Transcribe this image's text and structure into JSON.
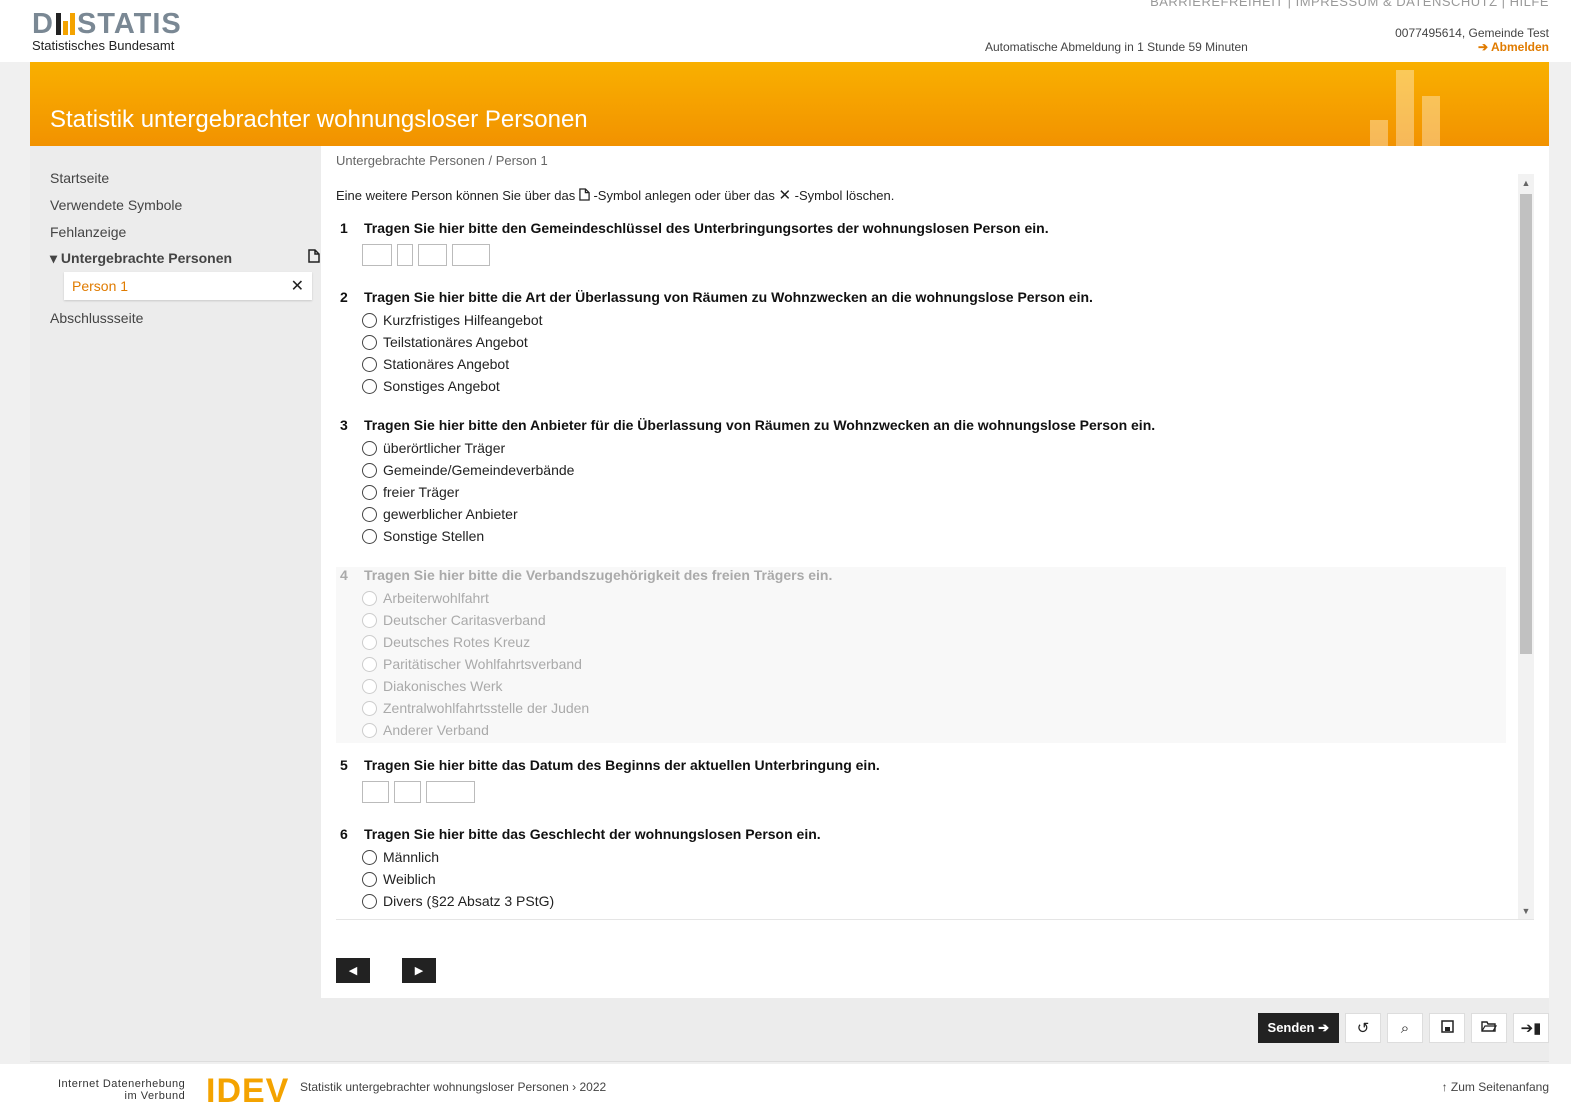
{
  "header": {
    "logo_text_left": "D",
    "logo_text_right": "STATIS",
    "logo_sub": "Statistisches Bundesamt",
    "top_links": "BARRIEREFREIHEIT | IMPRESSUM & DATENSCHUTZ | HILFE",
    "user": "0077495614, Gemeinde Test",
    "logout": "➔ Abmelden",
    "auto_logout": "Automatische Abmeldung in 1 Stunde 59 Minuten"
  },
  "banner": {
    "title": "Statistik untergebrachter wohnungsloser Personen"
  },
  "sidebar": {
    "items": [
      {
        "label": "Startseite"
      },
      {
        "label": "Verwendete Symbole"
      },
      {
        "label": "Fehlanzeige"
      },
      {
        "label": "▾ Untergebrachte Personen",
        "icon": "new-document-icon"
      },
      {
        "label": "Person 1",
        "icon": "delete-icon"
      },
      {
        "label": "Abschlussseite"
      }
    ]
  },
  "main": {
    "breadcrumb": "Untergebrachte Personen / Person 1",
    "intro_a": "Eine weitere Person können Sie über das ",
    "intro_b": "-Symbol anlegen oder über das ",
    "intro_c": "-Symbol löschen.",
    "questions": [
      {
        "num": "1",
        "text": "Tragen Sie hier bitte den Gemeindeschlüssel des Unterbringungsortes der wohnungslosen Person ein."
      },
      {
        "num": "2",
        "text": "Tragen Sie hier bitte die Art der Überlassung von Räumen zu Wohnzwecken an die wohnungslose Person ein.",
        "options": [
          "Kurzfristiges Hilfeangebot",
          "Teilstationäres Angebot",
          "Stationäres Angebot",
          "Sonstiges Angebot"
        ]
      },
      {
        "num": "3",
        "text": "Tragen Sie hier bitte den Anbieter für die Überlassung von Räumen zu Wohnzwecken an die wohnungslose Person ein.",
        "options": [
          "überörtlicher Träger",
          "Gemeinde/Gemeindeverbände",
          "freier Träger",
          "gewerblicher Anbieter",
          "Sonstige Stellen"
        ]
      },
      {
        "num": "4",
        "text": "Tragen Sie hier bitte die Verbandszugehörigkeit des freien Trägers ein.",
        "options": [
          "Arbeiterwohlfahrt",
          "Deutscher Caritasverband",
          "Deutsches Rotes Kreuz",
          "Paritätischer Wohlfahrtsverband",
          "Diakonisches Werk",
          "Zentralwohlfahrtsstelle der Juden",
          "Anderer Verband"
        ]
      },
      {
        "num": "5",
        "text": "Tragen Sie hier bitte das Datum des Beginns der aktuellen Unterbringung ein."
      },
      {
        "num": "6",
        "text": "Tragen Sie hier bitte das Geschlecht der wohnungslosen Person ein.",
        "options": [
          "Männlich",
          "Weiblich",
          "Divers (§22 Absatz 3 PStG)"
        ]
      }
    ]
  },
  "toolbar": {
    "send_label": "Senden ➔"
  },
  "footer": {
    "idev_small_1": "Internet Datenerhebung",
    "idev_small_2": "im Verbund",
    "idev_big": "IDEV",
    "text": "Statistik untergebrachter wohnungsloser Personen › 2022",
    "to_top": "↑ Zum Seitenanfang"
  },
  "colors": {
    "accent": "#f29200",
    "link": "#e07b00",
    "dark": "#222222"
  }
}
